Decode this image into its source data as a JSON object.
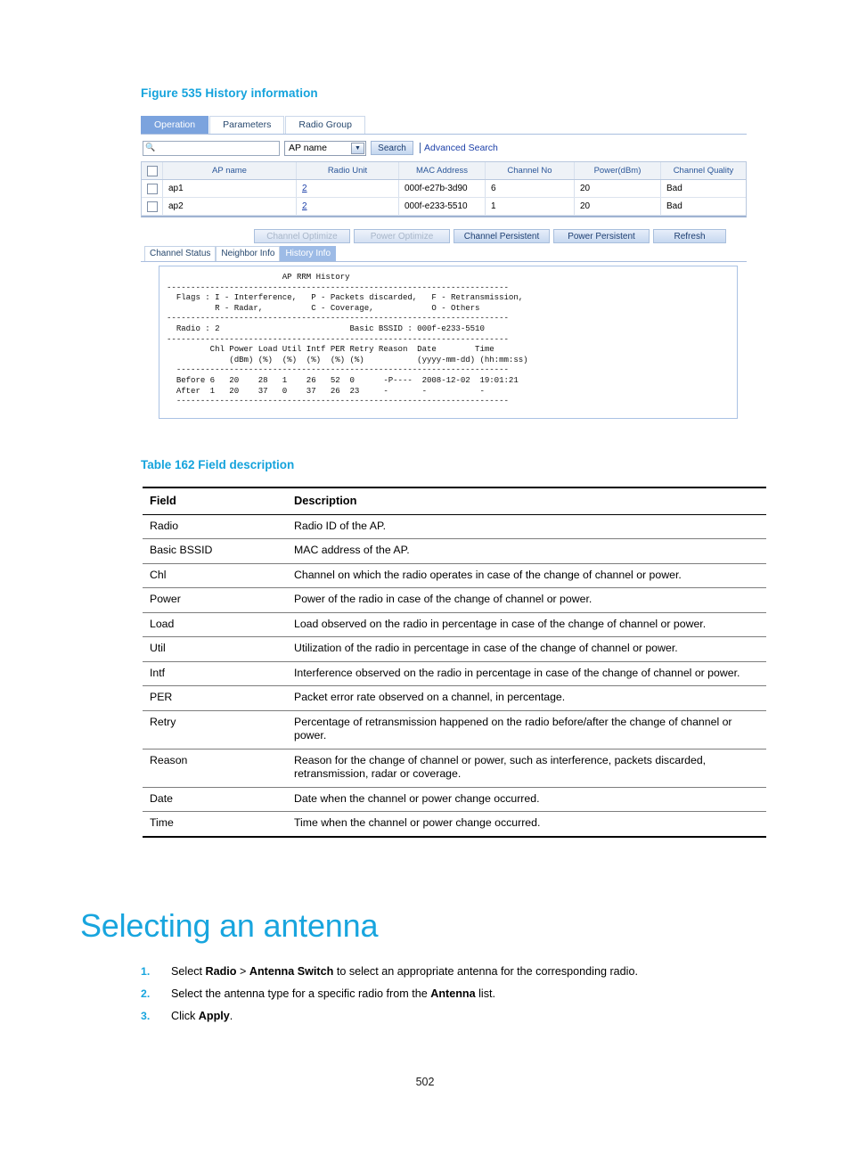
{
  "document": {
    "page_number": "502"
  },
  "figure": {
    "caption": "Figure 535 History information"
  },
  "screenshot": {
    "tabs": [
      {
        "label": "Operation",
        "selected": true
      },
      {
        "label": "Parameters",
        "selected": false
      },
      {
        "label": "Radio Group",
        "selected": false
      }
    ],
    "search": {
      "icon": "search-icon",
      "input_value": "",
      "input_placeholder": "",
      "select_value": "AP name",
      "select_options": [
        "AP name"
      ],
      "search_button": "Search",
      "advanced_search": "Advanced Search"
    },
    "grid": {
      "columns": [
        "AP name",
        "Radio Unit",
        "MAC Address",
        "Channel No",
        "Power(dBm)",
        "Channel Quality"
      ],
      "rows": [
        {
          "checked": false,
          "ap_name": "ap1",
          "radio_unit": "2",
          "mac_address": "000f-e27b-3d90",
          "channel_no": "6",
          "power": "20",
          "channel_quality": "Bad"
        },
        {
          "checked": false,
          "ap_name": "ap2",
          "radio_unit": "2",
          "mac_address": "000f-e233-5510",
          "channel_no": "1",
          "power": "20",
          "channel_quality": "Bad"
        }
      ]
    },
    "buttons": [
      {
        "label": "Channel Optimize",
        "disabled": true
      },
      {
        "label": "Power Optimize",
        "disabled": true
      },
      {
        "label": "Channel Persistent",
        "disabled": false
      },
      {
        "label": "Power Persistent",
        "disabled": false
      },
      {
        "label": "Refresh",
        "disabled": false
      }
    ],
    "sub_tabs": [
      {
        "label": "Channel Status",
        "selected": false
      },
      {
        "label": "Neighbor Info",
        "selected": false
      },
      {
        "label": "History Info",
        "selected": true
      }
    ],
    "console": {
      "text": "                        AP RRM History\n-----------------------------------------------------------------------\n  Flags : I - Interference,   P - Packets discarded,   F - Retransmission,\n          R - Radar,          C - Coverage,            O - Others\n-----------------------------------------------------------------------\n  Radio : 2                           Basic BSSID : 000f-e233-5510\n-----------------------------------------------------------------------\n         Chl Power Load Util Intf PER Retry Reason  Date        Time\n             (dBm) (%)  (%)  (%)  (%) (%)           (yyyy-mm-dd) (hh:mm:ss)\n  ---------------------------------------------------------------------\n  Before 6   20    28   1    26   52  0      -P----  2008-12-02  19:01:21\n  After  1   20    37   0    37   26  23     -       -           -\n  ---------------------------------------------------------------------"
    }
  },
  "field_table": {
    "caption": "Table 162 Field description",
    "headers": [
      "Field",
      "Description"
    ],
    "rows": [
      {
        "field": "Radio",
        "description": "Radio ID of the AP."
      },
      {
        "field": "Basic BSSID",
        "description": "MAC address of the AP."
      },
      {
        "field": "Chl",
        "description": "Channel on which the radio operates in case of the change of channel or power."
      },
      {
        "field": "Power",
        "description": "Power of the radio in case of the change of channel or power."
      },
      {
        "field": "Load",
        "description": "Load observed on the radio in percentage in case of the change of channel or power."
      },
      {
        "field": "Util",
        "description": "Utilization of the radio in percentage in case of the change of channel or power."
      },
      {
        "field": "Intf",
        "description": "Interference observed on the radio in percentage in case of the change of channel or power."
      },
      {
        "field": "PER",
        "description": "Packet error rate observed on a channel, in percentage."
      },
      {
        "field": "Retry",
        "description": "Percentage of retransmission happened on the radio before/after the change of channel or power."
      },
      {
        "field": "Reason",
        "description": "Reason for the change of channel or power, such as interference, packets discarded, retransmission, radar or coverage."
      },
      {
        "field": "Date",
        "description": "Date when the channel or power change occurred."
      },
      {
        "field": "Time",
        "description": "Time when the channel or power change occurred."
      }
    ]
  },
  "section": {
    "heading": "Selecting an antenna",
    "steps": [
      {
        "number": "1.",
        "parts": [
          {
            "text": "Select ",
            "bold": false
          },
          {
            "text": "Radio",
            "bold": true
          },
          {
            "text": " > ",
            "bold": false
          },
          {
            "text": "Antenna Switch",
            "bold": true
          },
          {
            "text": " to select an appropriate antenna for the corresponding radio.",
            "bold": false
          }
        ]
      },
      {
        "number": "2.",
        "parts": [
          {
            "text": "Select the antenna type for a specific radio from the ",
            "bold": false
          },
          {
            "text": "Antenna",
            "bold": true
          },
          {
            "text": " list.",
            "bold": false
          }
        ]
      },
      {
        "number": "3.",
        "parts": [
          {
            "text": "Click ",
            "bold": false
          },
          {
            "text": "Apply",
            "bold": true
          },
          {
            "text": ".",
            "bold": false
          }
        ]
      }
    ]
  },
  "colors": {
    "accent_blue": "#15a3dc",
    "heading_blue": "#18a5de",
    "link_blue": "#1b3fa8",
    "tab_selected": "#7ba3de",
    "subtab_selected": "#9dbbe6"
  }
}
